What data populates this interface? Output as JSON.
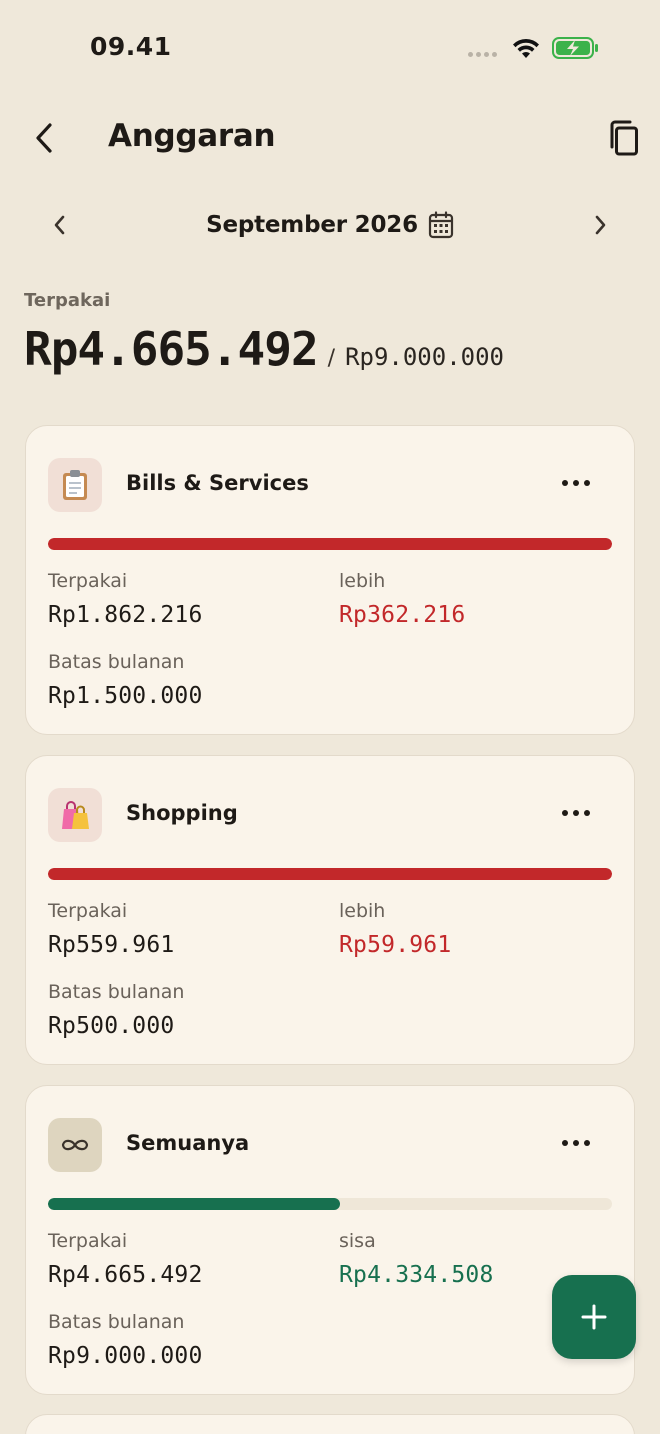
{
  "status_bar": {
    "time": "09.41"
  },
  "header": {
    "title": "Anggaran"
  },
  "month_nav": {
    "month": "September 2026"
  },
  "summary": {
    "label": "Terpakai",
    "spent": "Rp4.665.492",
    "separator": "/",
    "limit": "Rp9.000.000"
  },
  "budgets": [
    {
      "name": "Bills & Services",
      "icon": "clipboard-icon",
      "spent_label": "Terpakai",
      "spent": "Rp1.862.216",
      "diff_label": "lebih",
      "diff": "Rp362.216",
      "limit_label": "Batas bulanan",
      "limit": "Rp1.500.000",
      "progress": 1.0,
      "status": "over"
    },
    {
      "name": "Shopping",
      "icon": "shopping-bags-icon",
      "spent_label": "Terpakai",
      "spent": "Rp559.961",
      "diff_label": "lebih",
      "diff": "Rp59.961",
      "limit_label": "Batas bulanan",
      "limit": "Rp500.000",
      "progress": 1.0,
      "status": "over"
    },
    {
      "name": "Semuanya",
      "icon": "infinity-icon",
      "spent_label": "Terpakai",
      "spent": "Rp4.665.492",
      "diff_label": "sisa",
      "diff": "Rp4.334.508",
      "limit_label": "Batas bulanan",
      "limit": "Rp9.000.000",
      "progress": 0.518,
      "status": "under"
    }
  ],
  "colors": {
    "background": "#EFE8DA",
    "card": "#FAF4EA",
    "over": "#C2282A",
    "under": "#17704F",
    "accent": "#17704F"
  }
}
